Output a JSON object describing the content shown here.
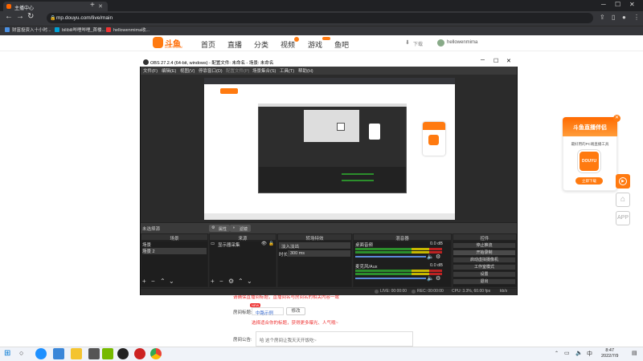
{
  "browser": {
    "tab_title": "主播中心",
    "url": "mp.douyu.com/live/main",
    "bookmarks": [
      "财富投资入十小时...",
      "bilibili哔哩哔哩_首楼...",
      "hellowenmima收..."
    ]
  },
  "site": {
    "logo_text": "斗鱼",
    "logo_sub": "DOUYU.COM",
    "nav": [
      "首页",
      "直播",
      "分类",
      "视频",
      "游戏",
      "鱼吧"
    ],
    "upload_label": "下载",
    "username": "hellowenmima"
  },
  "form": {
    "notice_red": "请确保直播间标题，直播间名与房间名的相关内容一致",
    "title_label": "房间标题:",
    "title_tag": "NEW",
    "title_value": "中路示例",
    "edit_button": "修改",
    "hint_red": "选择适合你的标题，获得更多曝光、人气哦~",
    "announce_label": "房间公告:",
    "announce_value": "哈 这个房间让我天天开饭吃~"
  },
  "ad": {
    "title": "斗鱼直播伴侣",
    "subtitle": "最好用的PC端直播工具",
    "app_text": "DOUYU",
    "button": "立即下载"
  },
  "obs": {
    "title": "OBS 27.2.4 (64-bit, windows) - 配置文件: 未命名 - 场景: 未命名",
    "menu": [
      "文件(F)",
      "编辑(E)",
      "视图(V)",
      "停靠窗口(D)",
      "配置文件(P)",
      "场景集合(S)",
      "工具(T)",
      "帮助(H)"
    ],
    "source_bar_label": "未选择源",
    "properties_button": "属性",
    "filters_button": "滤镜",
    "panels": {
      "scenes": {
        "header": "场景",
        "items": [
          "场景",
          "场景 2"
        ]
      },
      "sources": {
        "header": "来源",
        "items": [
          "显示器采集"
        ]
      },
      "transitions": {
        "header": "转场特效",
        "type": "淡入淡出",
        "duration_label": "时长",
        "duration_value": "300 ms"
      },
      "mixer": {
        "header": "混音器",
        "channels": [
          {
            "name": "桌面音频",
            "db": "0.0 dB"
          },
          {
            "name": "麦克风/Aux",
            "db": "0.0 dB"
          }
        ]
      },
      "controls": {
        "header": "控件",
        "buttons": [
          "停止推流",
          "开始录制",
          "启动虚拟摄像机",
          "工作室模式",
          "设置",
          "退出"
        ]
      }
    },
    "status": {
      "live": "LIVE: 00:00:00",
      "rec": "REC: 00:00:00",
      "cpu": "CPU: 3.3%, 60.00 fps",
      "kbps": "kb/s"
    }
  },
  "taskbar": {
    "time": "8:47",
    "date": "2022/7/9"
  }
}
